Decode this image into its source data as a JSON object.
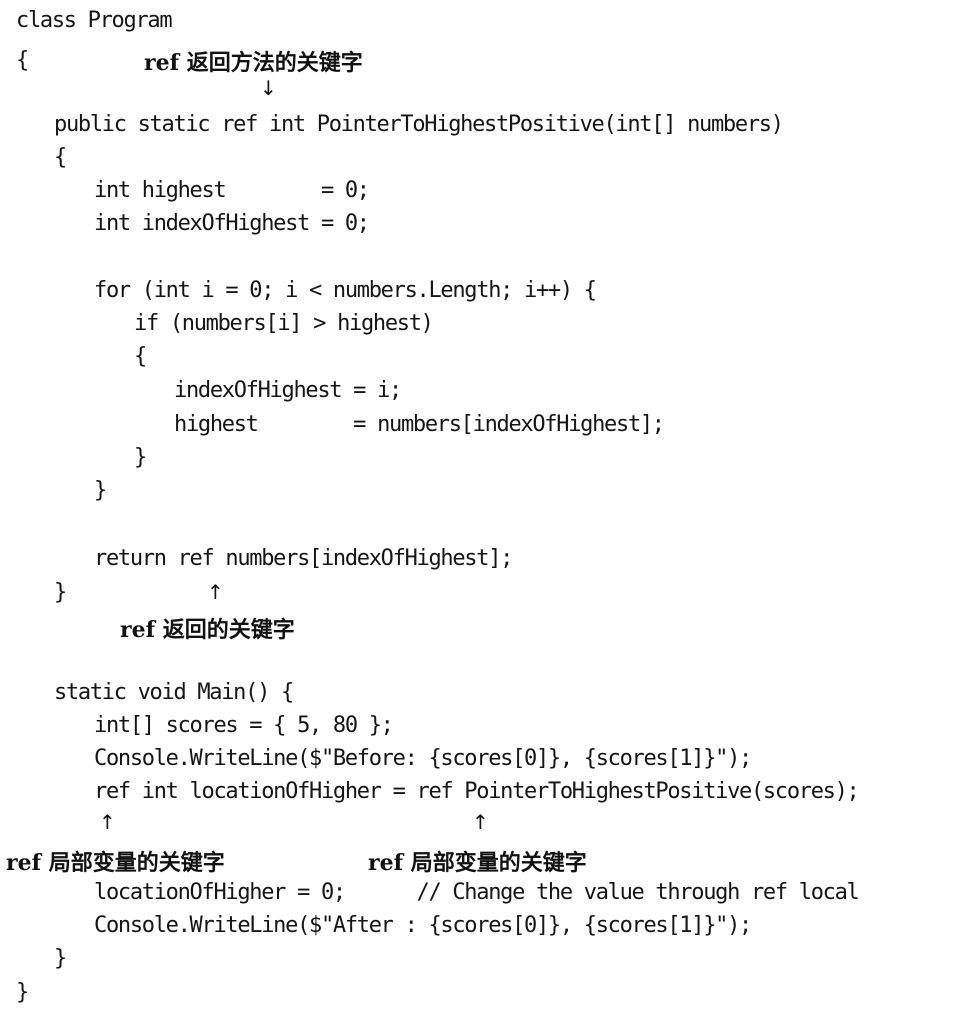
{
  "code_lines": [
    {
      "text": "class Program"
    },
    {
      "text": "{"
    },
    {
      "text": "public static ref int PointerToHighestPositive(int[] numbers)"
    },
    {
      "text": "{"
    },
    {
      "text": "int highest        = 0;"
    },
    {
      "text": "int indexOfHighest = 0;"
    },
    {
      "text": "for (int i = 0; i < numbers.Length; i++) {"
    },
    {
      "text": "if (numbers[i] > highest)"
    },
    {
      "text": "{"
    },
    {
      "text": "indexOfHighest = i;"
    },
    {
      "text": "highest        = numbers[indexOfHighest];"
    },
    {
      "text": "}"
    },
    {
      "text": "}"
    },
    {
      "text": "return ref numbers[indexOfHighest];"
    },
    {
      "text": "}"
    },
    {
      "text": "static void Main() {"
    },
    {
      "text": "int[] scores = { 5, 80 };"
    },
    {
      "text": "Console.WriteLine($\"Before: {scores[0]}, {scores[1]}\");"
    },
    {
      "text": "ref int locationOfHigher = ref PointerToHighestPositive(scores);"
    },
    {
      "text": "locationOfHigher = 0;      // Change the value through ref local"
    },
    {
      "text": "Console.WriteLine($\"After : {scores[0]}, {scores[1]}\");"
    },
    {
      "text": "}"
    },
    {
      "text": "}"
    }
  ],
  "annotations": {
    "ref_return_method": {
      "kw": "ref",
      "label": "返回方法的关键字"
    },
    "ref_return": {
      "kw": "ref",
      "label": "返回的关键字"
    },
    "ref_local_1": {
      "kw": "ref",
      "label": "局部变量的关键字"
    },
    "ref_local_2": {
      "kw": "ref",
      "label": "局部变量的关键字"
    }
  },
  "arrows": {
    "down": "↓",
    "up": "↑"
  }
}
